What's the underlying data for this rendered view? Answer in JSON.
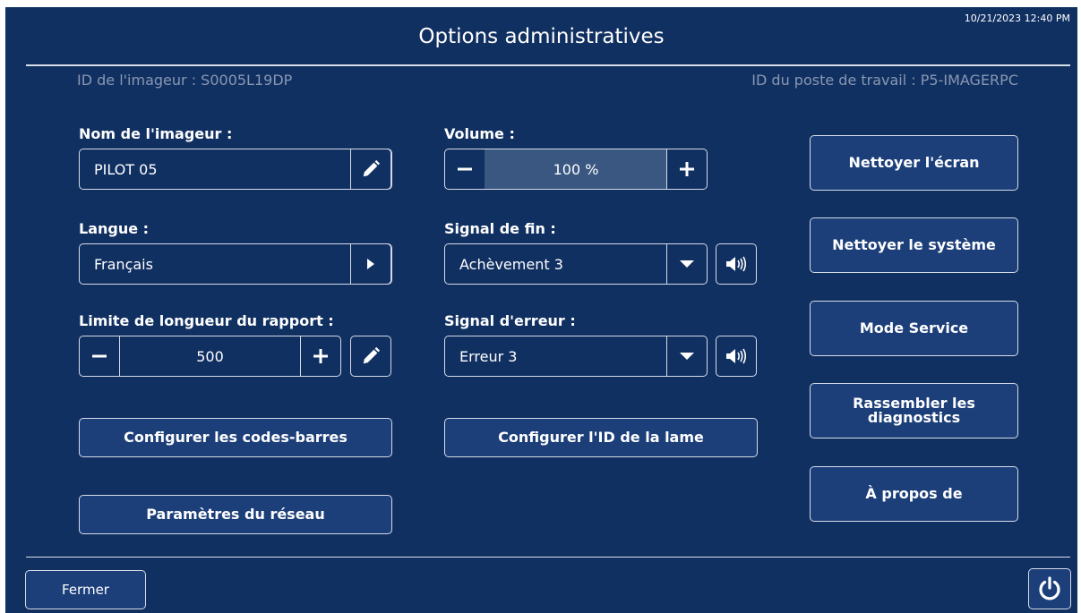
{
  "header": {
    "datetime": "10/21/2023 12:40 PM",
    "title": "Options administratives",
    "imager_id": "ID de l'imageur : S0005L19DP",
    "workstation_id": "ID du poste de travail : P5-IMAGERPC"
  },
  "left": {
    "imager_name_label": "Nom de l'imageur :",
    "imager_name_value": "PILOT 05",
    "language_label": "Langue :",
    "language_value": "Français",
    "report_limit_label": "Limite de longueur du rapport :",
    "report_limit_value": "500",
    "barcodes_button": "Configurer les codes-barres",
    "network_button": "Paramètres du réseau"
  },
  "middle": {
    "volume_label": "Volume :",
    "volume_value": "100 %",
    "end_signal_label": "Signal de fin :",
    "end_signal_value": "Achèvement 3",
    "error_signal_label": "Signal d'erreur :",
    "error_signal_value": "Erreur 3",
    "slide_id_button": "Configurer l'ID de la lame"
  },
  "right": {
    "clean_screen_button": "Nettoyer l'écran",
    "clean_system_button": "Nettoyer le système",
    "service_mode_button": "Mode Service",
    "diagnostics_button": "Rassembler les\ndiagnostics",
    "about_button": "À propos de"
  },
  "footer": {
    "close_button": "Fermer"
  },
  "icons": {
    "edit": "pencil-icon",
    "arrow": "play-arrow-icon",
    "minus": "minus-icon",
    "plus": "plus-icon",
    "dropdown": "caret-down-icon",
    "speaker": "speaker-icon",
    "power": "power-icon"
  },
  "colors": {
    "background": "#113062",
    "button": "#1c3f7a",
    "border": "#d5dbe6",
    "muted_text": "#8897b2",
    "volume_fill": "#3a5781"
  }
}
